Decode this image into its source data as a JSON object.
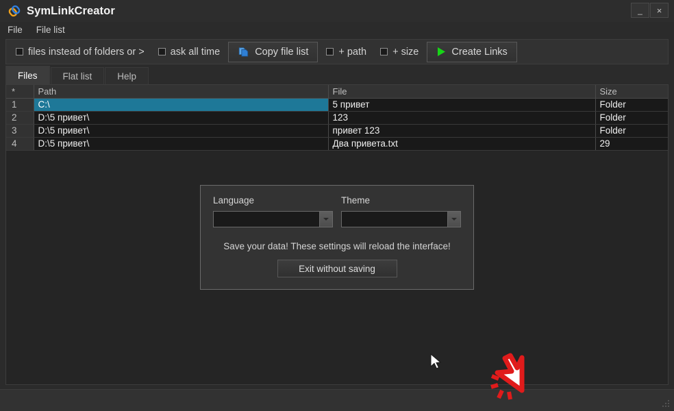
{
  "window": {
    "title": "SymLinkCreator",
    "app_icon": "chain-link-icon",
    "minimize_label": "_",
    "close_label": "×"
  },
  "menubar": {
    "items": [
      {
        "label": "File"
      },
      {
        "label": "File list"
      }
    ]
  },
  "toolbar": {
    "checkboxes": [
      {
        "label": "files instead of folders or >",
        "checked": false
      },
      {
        "label": "ask all time",
        "checked": false
      },
      {
        "label": "+ path",
        "checked": false
      },
      {
        "label": "+ size",
        "checked": false
      }
    ],
    "copy_button": {
      "label": "Copy file list",
      "icon": "copy-icon"
    },
    "create_button": {
      "label": "Create Links",
      "icon": "play-icon",
      "icon_color": "#17d517"
    }
  },
  "tabs": [
    {
      "label": "Files",
      "active": true
    },
    {
      "label": "Flat list",
      "active": false
    },
    {
      "label": "Help",
      "active": false
    }
  ],
  "grid": {
    "headers": [
      "*",
      "Path",
      "File",
      "Size"
    ],
    "rows": [
      {
        "n": "1",
        "path": "C:\\",
        "file": "5 привет",
        "size": "Folder",
        "selected": true
      },
      {
        "n": "2",
        "path": "D:\\5 привет\\",
        "file": "123",
        "size": "Folder",
        "selected": false
      },
      {
        "n": "3",
        "path": "D:\\5 привет\\",
        "file": "привет 123",
        "size": "Folder",
        "selected": false
      },
      {
        "n": "4",
        "path": "D:\\5 привет\\",
        "file": "Два привета.txt",
        "size": "29",
        "selected": false
      }
    ]
  },
  "settings_dialog": {
    "language": {
      "label": "Language",
      "value": ""
    },
    "theme": {
      "label": "Theme",
      "value": ""
    },
    "notice": "Save your data! These settings will reload the interface!",
    "exit_button": "Exit without saving"
  },
  "statusbar": {
    "text": "",
    "grip": "resize-grip-icon"
  },
  "colors": {
    "selection": "#1e7898",
    "accent_green": "#17d517",
    "click_marker": "#e01b1b",
    "window_bg": "#2b2b2b",
    "grid_bg": "#191919"
  }
}
